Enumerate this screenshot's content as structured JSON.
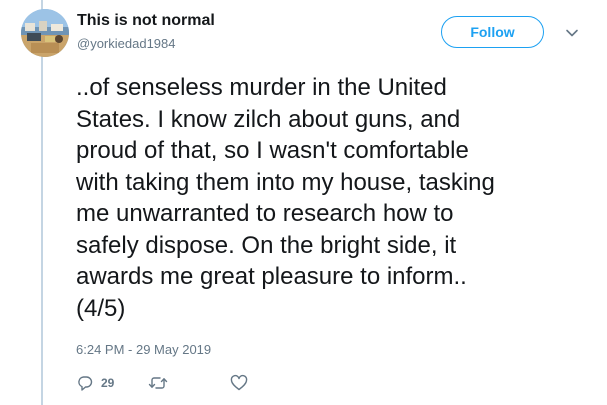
{
  "tweet": {
    "display_name": "This is not normal",
    "handle": "@yorkiedad1984",
    "follow_label": "Follow",
    "text": "..of senseless murder in the United\nStates. I know zilch about guns, and\nproud of that, so I wasn't comfortable\nwith taking them into my house, tasking\nme unwarranted to research how to\nsafely dispose. On the bright side, it\nawards me great pleasure to inform..\n(4/5)",
    "timestamp": "6:24 PM - 29 May 2019",
    "reply_count": "29"
  },
  "icons": {
    "avatar": "profile-photo",
    "caret": "chevron-down-icon",
    "reply": "reply-icon",
    "retweet": "retweet-icon",
    "like": "heart-icon"
  },
  "colors": {
    "accent": "#1da1f2",
    "secondary_text": "#657786",
    "primary_text": "#14171a",
    "thread_line": "#c4d5e3"
  }
}
